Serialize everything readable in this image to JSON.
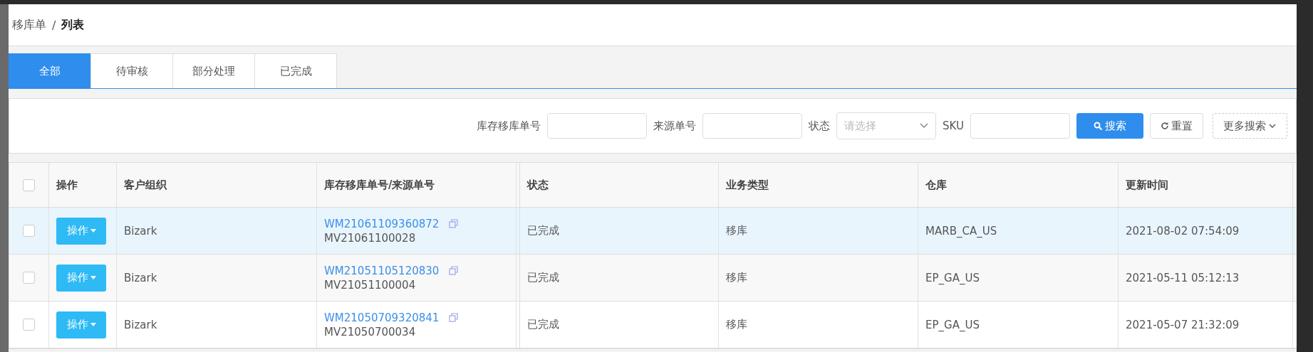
{
  "breadcrumb": {
    "parent": "移库单",
    "separator": "/",
    "current": "列表"
  },
  "tabs": [
    {
      "label": "全部",
      "selected": true
    },
    {
      "label": "待审核",
      "selected": false
    },
    {
      "label": "部分处理",
      "selected": false
    },
    {
      "label": "已完成",
      "selected": false
    }
  ],
  "search": {
    "fields": [
      {
        "label": "库存移库单号",
        "kind": "input"
      },
      {
        "label": "来源单号",
        "kind": "input"
      },
      {
        "label": "状态",
        "kind": "select",
        "placeholder": "请选择"
      },
      {
        "label": "SKU",
        "kind": "input"
      }
    ],
    "search_button": "搜索",
    "reset_button": "重置",
    "more_button": "更多搜索"
  },
  "table": {
    "select_all_checked": false,
    "columns": [
      "操作",
      "客户组织",
      "库存移库单号/来源单号",
      "状态",
      "业务类型",
      "仓库",
      "更新时间"
    ],
    "rows": [
      {
        "checked": false,
        "highlighted": true,
        "action": "操作",
        "customer": "Bizark",
        "move_no": "WM21061109360872",
        "source_no": "MV21061100028",
        "status": "已完成",
        "business_type": "移库",
        "warehouse": "MARB_CA_US",
        "updated": "2021-08-02 07:54:09"
      },
      {
        "checked": false,
        "highlighted": false,
        "action": "操作",
        "customer": "Bizark",
        "move_no": "WM21051105120830",
        "source_no": "MV21051100004",
        "status": "已完成",
        "business_type": "移库",
        "warehouse": "EP_GA_US",
        "updated": "2021-05-11 05:12:13"
      },
      {
        "checked": false,
        "highlighted": false,
        "action": "操作",
        "customer": "Bizark",
        "move_no": "WM21050709320841",
        "source_no": "MV21050700034",
        "status": "已完成",
        "business_type": "移库",
        "warehouse": "EP_GA_US",
        "updated": "2021-05-07 21:32:09"
      }
    ]
  }
}
